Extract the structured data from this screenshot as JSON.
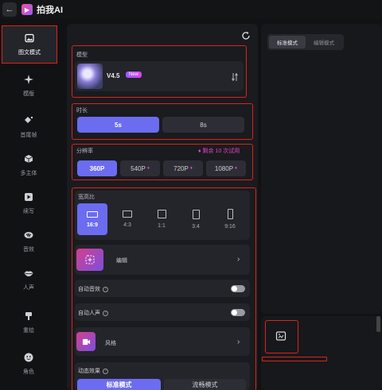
{
  "app": {
    "title": "拍我AI",
    "back_icon": "back-arrow-icon",
    "logo_icon": "app-logo-icon"
  },
  "sidebar": {
    "items": [
      {
        "label": "图文模式",
        "icon": "image-icon",
        "active": true
      },
      {
        "label": "模版",
        "icon": "sparkle-icon",
        "active": false
      },
      {
        "label": "首尾帧",
        "icon": "keyframe-icon",
        "active": false
      },
      {
        "label": "多主体",
        "icon": "cube-icon",
        "active": false
      },
      {
        "label": "续写",
        "icon": "play-icon",
        "active": false
      },
      {
        "label": "音效",
        "icon": "sound-icon",
        "active": false
      },
      {
        "label": "人声",
        "icon": "lips-icon",
        "active": false
      },
      {
        "label": "重绘",
        "icon": "brush-icon",
        "active": false
      },
      {
        "label": "角色",
        "icon": "character-icon",
        "active": false
      }
    ]
  },
  "panel": {
    "model": {
      "section_label": "模型",
      "name": "V4.5",
      "badge": "New"
    },
    "duration": {
      "section_label": "时长",
      "options": [
        "5s",
        "8s"
      ],
      "selected": "5s"
    },
    "resolution": {
      "section_label": "分辨率",
      "remaining": "剩余 10 次试用",
      "options": [
        "360P",
        "540P",
        "720P",
        "1080P"
      ],
      "selected": "360P"
    },
    "aspect": {
      "section_label": "宽高比",
      "options": [
        "16:9",
        "4:3",
        "1:1",
        "3:4",
        "9:16"
      ],
      "selected": "16:9"
    },
    "edit_label": "编辑",
    "auto_sound_label": "自动音效",
    "auto_voice_label": "自动人声",
    "style_label": "风格",
    "effect": {
      "section_label": "动态效果",
      "options": [
        "标准模式",
        "流畅模式"
      ],
      "selected": "标准模式"
    }
  },
  "right": {
    "tabs": [
      "标准模式",
      "编辑模式"
    ],
    "selected_tab": "标准模式"
  },
  "colors": {
    "accent": "#6b6cf0",
    "highlight_box": "#d9241c",
    "gem": "#e243c5"
  }
}
